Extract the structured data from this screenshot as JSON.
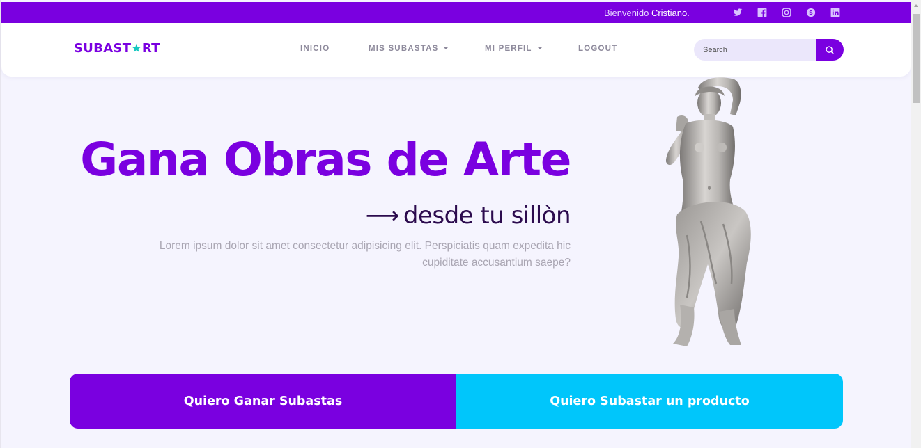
{
  "topbar": {
    "welcome_prefix": "Bienvenido",
    "user_name": "Cristiano",
    "suffix": ".",
    "social_icons": [
      "twitter-icon",
      "facebook-icon",
      "instagram-icon",
      "skype-icon",
      "linkedin-icon"
    ],
    "color": "#7a00e0"
  },
  "navbar": {
    "logo_before": "SUBAST",
    "logo_star": "★",
    "logo_after": "RT",
    "items": [
      {
        "label": "INICIO",
        "dropdown": false
      },
      {
        "label": "MIS SUBASTAS",
        "dropdown": true
      },
      {
        "label": "MI PERFIL",
        "dropdown": true
      },
      {
        "label": "LOGOUT",
        "dropdown": false
      }
    ],
    "search_placeholder": "Search"
  },
  "hero": {
    "title": "Gana Obras de Arte",
    "arrow": "⟶",
    "subtitle": "desde tu sillòn",
    "description": "Lorem ipsum dolor sit amet consectetur adipisicing elit. Perspiciatis quam expedita hic cupiditate accusantium saepe?"
  },
  "cta": {
    "left_label": "Quiero Ganar Subastas",
    "right_label": "Quiero Subastar un producto",
    "left_color": "#7a00e0",
    "right_color": "#00c6fb"
  }
}
